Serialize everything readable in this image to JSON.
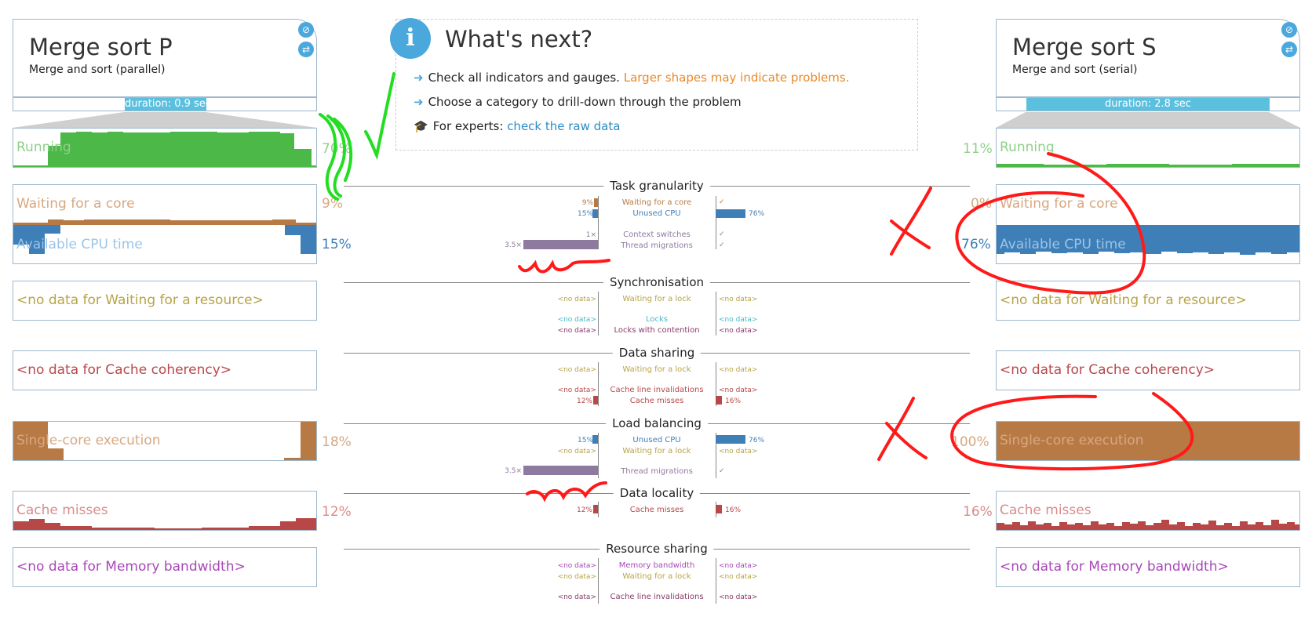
{
  "left_panel": {
    "title": "Merge sort P",
    "subtitle": "Merge and sort (parallel)",
    "duration": "duration: 0.9 sec"
  },
  "right_panel": {
    "title": "Merge sort S",
    "subtitle": "Merge and sort (serial)",
    "duration": "duration: 2.8 sec"
  },
  "metrics": {
    "running": {
      "label": "Running",
      "left_pct": "70%",
      "right_pct": "11%"
    },
    "waiting_core": {
      "label": "Waiting for a core",
      "left_pct": "9%",
      "right_pct": "0%"
    },
    "available_cpu": {
      "label": "Available CPU time",
      "left_pct": "15%",
      "right_pct": "76%"
    },
    "resource": {
      "label": "<no data for Waiting for a resource>"
    },
    "cache_coherency": {
      "label": "<no data for Cache coherency>"
    },
    "single_core": {
      "label": "Single-core execution",
      "left_pct": "18%",
      "right_pct": "100%"
    },
    "cache_misses": {
      "label": "Cache misses",
      "left_pct": "12%",
      "right_pct": "16%"
    },
    "memory_bw": {
      "label": "<no data for Memory bandwidth>"
    }
  },
  "whats_next": {
    "title": "What's next?",
    "line1": "Check all indicators and gauges.",
    "line1_warning": "Larger shapes may indicate problems.",
    "line2": "Choose a category to drill-down through the problem",
    "line3_prefix": "For experts:",
    "line3_link": "check the raw data"
  },
  "sections": {
    "task_granularity": {
      "title": "Task granularity",
      "rows": [
        {
          "label": "Waiting for a core",
          "left": "9%",
          "right": "✓"
        },
        {
          "label": "Unused CPU",
          "left": "15%",
          "right": "76%"
        },
        {
          "label": "Context switches",
          "left": "1×",
          "right": "✓"
        },
        {
          "label": "Thread migrations",
          "left": "3.5×",
          "right": "✓"
        }
      ]
    },
    "synchronisation": {
      "title": "Synchronisation",
      "rows": [
        {
          "label": "Waiting for a lock",
          "left": "<no data>",
          "right": "<no data>"
        },
        {
          "label": "Locks",
          "left": "<no data>",
          "right": "<no data>"
        },
        {
          "label": "Locks with contention",
          "left": "<no data>",
          "right": "<no data>"
        }
      ]
    },
    "data_sharing": {
      "title": "Data sharing",
      "rows": [
        {
          "label": "Waiting for a lock",
          "left": "<no data>",
          "right": "<no data>"
        },
        {
          "label": "Cache line invalidations",
          "left": "<no data>",
          "right": "<no data>"
        },
        {
          "label": "Cache misses",
          "left": "12%",
          "right": "16%"
        }
      ]
    },
    "load_balancing": {
      "title": "Load balancing",
      "rows": [
        {
          "label": "Unused CPU",
          "left": "15%",
          "right": "76%"
        },
        {
          "label": "Waiting for a lock",
          "left": "<no data>",
          "right": "<no data>"
        },
        {
          "label": "Thread migrations",
          "left": "3.5×",
          "right": "✓"
        }
      ]
    },
    "data_locality": {
      "title": "Data locality",
      "rows": [
        {
          "label": "Cache misses",
          "left": "12%",
          "right": "16%"
        }
      ]
    },
    "resource_sharing": {
      "title": "Resource sharing",
      "rows": [
        {
          "label": "Memory bandwidth",
          "left": "<no data>",
          "right": "<no data>"
        },
        {
          "label": "Waiting for a lock",
          "left": "<no data>",
          "right": "<no data>"
        },
        {
          "label": "Cache line invalidations",
          "left": "<no data>",
          "right": "<no data>"
        }
      ]
    }
  },
  "colors": {
    "running": "#4cb848",
    "waiting_core": "#b87a45",
    "available_cpu": "#3f7fb8",
    "resource": "#b8a448",
    "cache_coherency": "#b8484b",
    "single_core": "#b87a45",
    "cache_misses": "#b84848",
    "memory_bw": "#a848b8",
    "thread_migrations": "#8f7a9f",
    "accent": "#4aa8dc",
    "annotation_red": "#ff1a1a",
    "annotation_green": "#22dd22"
  },
  "icons": {
    "info": "info-icon",
    "arrow": "arrow-right-icon",
    "mortarboard": "mortarboard-icon",
    "pin": "pin-icon",
    "swap": "swap-icon"
  }
}
